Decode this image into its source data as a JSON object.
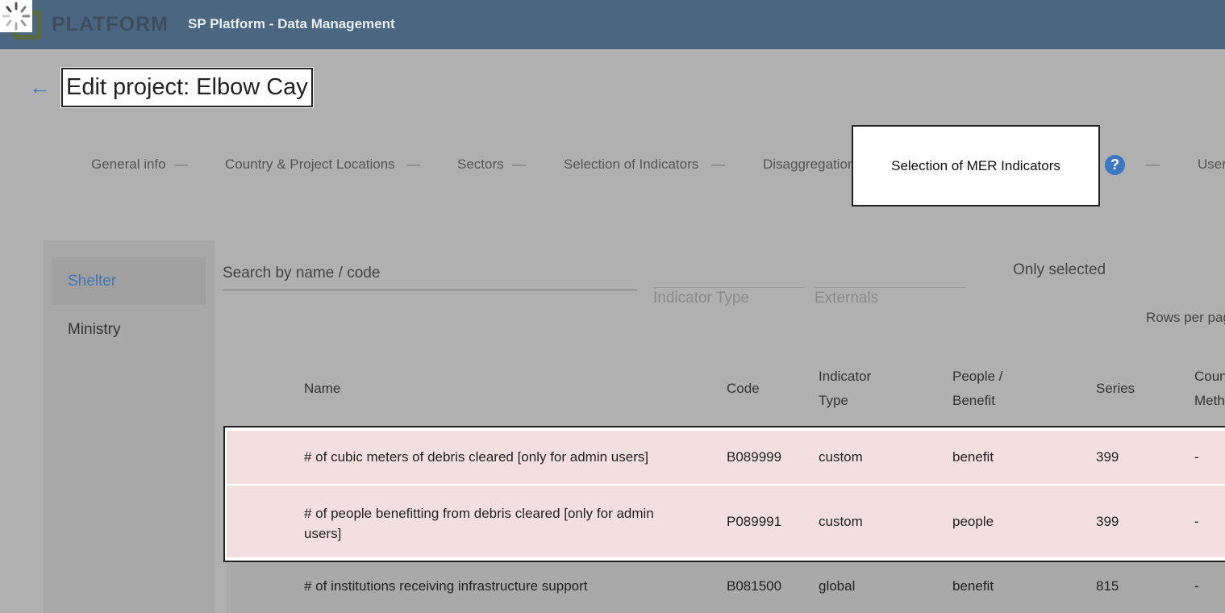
{
  "header": {
    "logo_text": "PLATFORM",
    "app_title": "SP Platform - Data Management",
    "bg_color": "#4a6680"
  },
  "page": {
    "back_icon": "arrow-left-icon",
    "title": "Edit project: Elbow Cay"
  },
  "stepper": {
    "steps": [
      "General info",
      "Country & Project Locations",
      "Sectors",
      "Selection of Indicators",
      "Disaggregation",
      "Selection of MER Indicators",
      "User"
    ],
    "active_index": 5,
    "dash": "—",
    "help_icon": "help-circle-icon",
    "help_glyph": "?"
  },
  "sidebar": {
    "items": [
      {
        "label": "Shelter",
        "active": true
      },
      {
        "label": "Ministry",
        "active": false
      }
    ]
  },
  "filters": {
    "search_placeholder": "Search by name / code",
    "indicator_type_placeholder": "Indicator Type",
    "externals_placeholder": "Externals",
    "only_selected_label": "Only selected",
    "rows_per_page_label": "Rows per pag"
  },
  "table": {
    "headers": {
      "name": "Name",
      "code": "Code",
      "indicator_type_1": "Indicator",
      "indicator_type_2": "Type",
      "people_benefit_1": "People /",
      "people_benefit_2": "Benefit",
      "series": "Series",
      "count_method_1": "Coun",
      "count_method_2": "Meth"
    },
    "rows": [
      {
        "name": "# of cubic meters of debris cleared [only for admin users]",
        "code": "B089999",
        "type": "custom",
        "people_benefit": "benefit",
        "series": "399",
        "count": "-",
        "selected": true
      },
      {
        "name_line1": "# of people benefitting from debris cleared [only for admin",
        "name_line2": "users]",
        "code": "P089991",
        "type": "custom",
        "people_benefit": "people",
        "series": "399",
        "count": "-",
        "selected": true
      },
      {
        "name": "# of institutions receiving infrastructure support",
        "code": "B081500",
        "type": "global",
        "people_benefit": "benefit",
        "series": "815",
        "count": "-",
        "selected": false
      }
    ]
  }
}
